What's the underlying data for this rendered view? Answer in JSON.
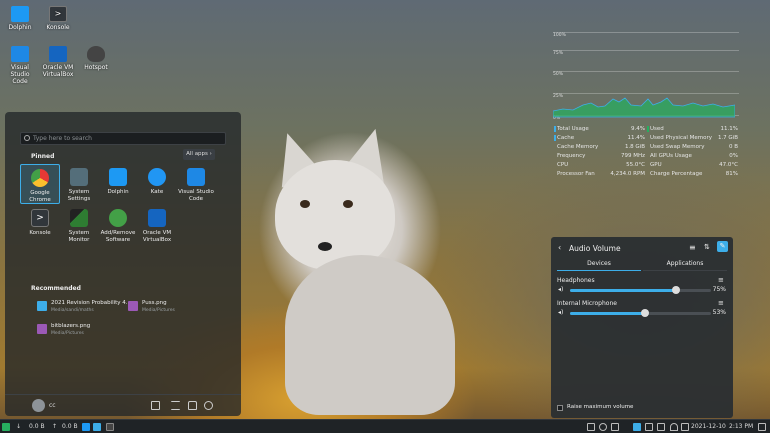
{
  "desktop": {
    "icons": [
      {
        "label": "Dolphin",
        "icon": "folder-icon",
        "color": "#1d99f3"
      },
      {
        "label": "Konsole",
        "icon": "terminal-icon",
        "color": "#31363b"
      },
      {
        "label": "Visual Studio Code",
        "icon": "vscode-icon",
        "color": "#1e88e5"
      },
      {
        "label": "Oracle VM VirtualBox",
        "icon": "virtualbox-icon",
        "color": "#1565c0"
      },
      {
        "label": "Hotspot",
        "icon": "hotspot-icon",
        "color": "#444"
      }
    ]
  },
  "menu": {
    "search_placeholder": "Type here to search",
    "pinned_title": "Pinned",
    "all_apps_label": "All apps",
    "pinned": [
      {
        "label": "Google Chrome",
        "icon": "chrome-icon",
        "color": "#e53935"
      },
      {
        "label": "System Settings",
        "icon": "settings-icon",
        "color": "#546e7a"
      },
      {
        "label": "Dolphin",
        "icon": "folder-icon",
        "color": "#1d99f3"
      },
      {
        "label": "Kate",
        "icon": "kate-icon",
        "color": "#2196f3"
      },
      {
        "label": "Visual Studio Code",
        "icon": "vscode-icon",
        "color": "#1e88e5"
      },
      {
        "label": "Konsole",
        "icon": "terminal-icon",
        "color": "#31363b"
      },
      {
        "label": "System Monitor",
        "icon": "monitor-icon",
        "color": "#2e7d32"
      },
      {
        "label": "Add/Remove Software",
        "icon": "software-icon",
        "color": "#43a047"
      },
      {
        "label": "Oracle VM VirtualBox",
        "icon": "virtualbox-icon",
        "color": "#1565c0"
      }
    ],
    "recommended_title": "Recommended",
    "recommended": [
      {
        "name": "2021 Revision Probability 4...",
        "path": "Media/sandi/maths",
        "icon": "document-icon",
        "color": "#3daee9"
      },
      {
        "name": "Puss.png",
        "path": "Media/Pictures",
        "icon": "image-icon",
        "color": "#9b59b6"
      },
      {
        "name": "bitblazers.png",
        "path": "Media/Pictures",
        "icon": "image-icon",
        "color": "#9b59b6"
      }
    ],
    "user": "cc"
  },
  "monitor": {
    "grid_labels": [
      "100%",
      "75%",
      "50%",
      "25%",
      "0%"
    ],
    "left_stats": [
      {
        "label": "Total Usage",
        "value": "9.4%"
      },
      {
        "label": "Cache",
        "value": "11.4%"
      },
      {
        "label": "Cache Memory",
        "value": "1.8 GiB"
      },
      {
        "label": "Frequency",
        "value": "799 MHz"
      },
      {
        "label": "CPU",
        "value": "55.0°C"
      },
      {
        "label": "Processor Fan",
        "value": "4,234.0 RPM"
      }
    ],
    "right_stats": [
      {
        "label": "Used",
        "value": "11.1%"
      },
      {
        "label": "Used Physical Memory",
        "value": "1.7 GiB"
      },
      {
        "label": "Used Swap Memory",
        "value": "0 B"
      },
      {
        "label": "All GPUs Usage",
        "value": "0%"
      },
      {
        "label": "GPU",
        "value": "47.0°C"
      },
      {
        "label": "Charge Percentage",
        "value": "81%"
      }
    ]
  },
  "audio": {
    "title": "Audio Volume",
    "tabs": [
      "Devices",
      "Applications"
    ],
    "devices": [
      {
        "name": "Headphones",
        "percent": "75%",
        "level": 0.75
      },
      {
        "name": "Internal Microphone",
        "percent": "53%",
        "level": 0.53
      }
    ],
    "raise_max_label": "Raise maximum volume"
  },
  "taskbar": {
    "net_down": "0.0 B",
    "net_up": "0.0 B",
    "datetime": "2021-12-10",
    "time": "2:13 PM"
  }
}
